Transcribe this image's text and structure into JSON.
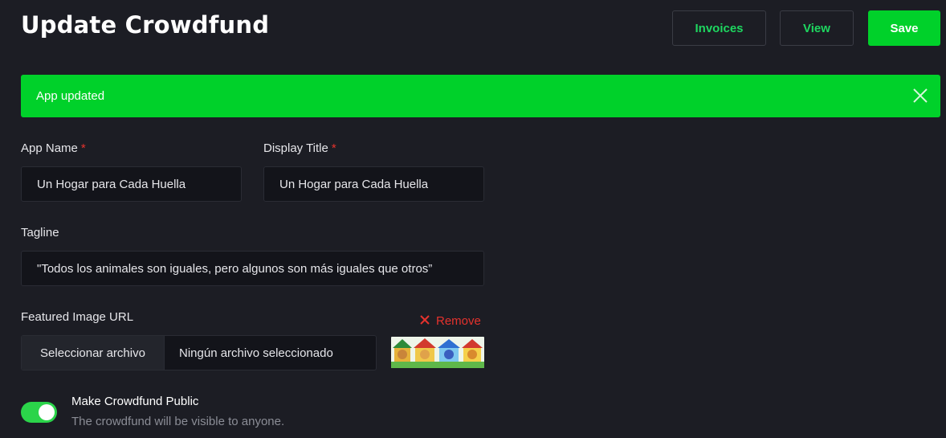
{
  "page": {
    "title": "Update Crowdfund"
  },
  "header_actions": {
    "invoices_label": "Invoices",
    "view_label": "View",
    "save_label": "Save"
  },
  "alert": {
    "message": "App updated",
    "icon": "close-icon"
  },
  "form": {
    "app_name": {
      "label": "App Name",
      "required_mark": "*",
      "value": "Un Hogar para Cada Huella"
    },
    "display_title": {
      "label": "Display Title",
      "required_mark": "*",
      "value": "Un Hogar para Cada Huella"
    },
    "tagline": {
      "label": "Tagline",
      "value": "\"Todos los animales son iguales, pero algunos son más iguales que otros”"
    },
    "featured_image": {
      "label": "Featured Image URL",
      "remove_label": "Remove",
      "choose_file_label": "Seleccionar archivo",
      "no_file_label": "Ningún archivo seleccionado",
      "thumbnail": "cartoon-dogs-doghouses-image"
    },
    "public_toggle": {
      "label": "Make Crowdfund Public",
      "help": "The crowdfund will be visible to anyone.",
      "checked": true
    }
  },
  "colors": {
    "background": "#1c1d24",
    "accent_green": "#00d12a",
    "button_text_green": "#1ed760",
    "danger_red": "#e5322d",
    "input_bg": "#13141a"
  }
}
